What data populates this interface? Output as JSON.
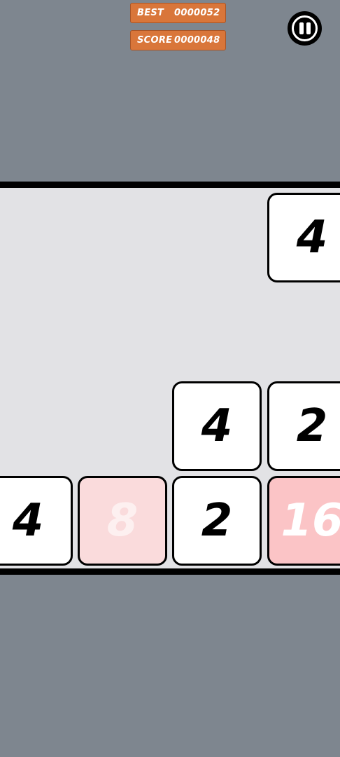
{
  "hud": {
    "best_label": "BEST",
    "best_value": "0000052",
    "score_label": "SCORE",
    "score_value": "0000048"
  },
  "colors": {
    "background": "#7e868f",
    "board": "#e2e2e5",
    "badge": "#d9763a",
    "tile_white": "#ffffff",
    "tile_8": "#fadbdc",
    "tile_16": "#fbc4c6"
  },
  "tiles": [
    {
      "value": "4"
    },
    {
      "value": "4"
    },
    {
      "value": "2"
    },
    {
      "value": "4"
    },
    {
      "value": "8"
    },
    {
      "value": "2"
    },
    {
      "value": "16"
    }
  ]
}
